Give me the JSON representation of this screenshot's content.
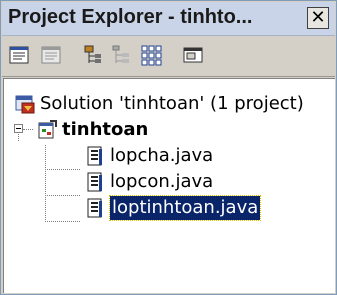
{
  "window": {
    "title": "Project Explorer - tinhto...",
    "close_glyph": "✕"
  },
  "toolbar": {
    "buttons": [
      {
        "name": "properties-icon"
      },
      {
        "name": "show-all-files-icon"
      },
      {
        "name": "class-view-icon"
      },
      {
        "name": "hierarchy-icon"
      },
      {
        "name": "grid-icon"
      },
      {
        "name": "view-icon"
      }
    ]
  },
  "tree": {
    "solution": "Solution 'tinhtoan' (1 project)",
    "project": "tinhtoan",
    "files": [
      "lopcha.java",
      "lopcon.java",
      "loptinhtoan.java"
    ],
    "selected_index": 2
  },
  "colors": {
    "selection": "#0a246a",
    "title_bg": "#c9d4e8"
  }
}
